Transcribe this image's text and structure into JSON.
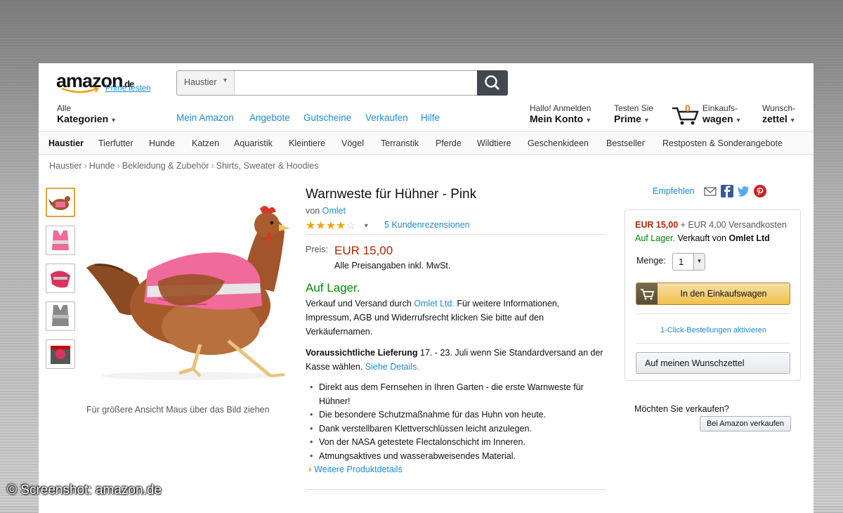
{
  "header": {
    "logo_text": "amazon",
    "logo_tld": ".de",
    "prime_link": "Prime testen",
    "search": {
      "category": "Haustier",
      "placeholder": ""
    },
    "all_categories_small": "Alle",
    "all_categories_big": "Kategorien",
    "nav_links": [
      "Mein Amazon",
      "Angebote",
      "Gutscheine",
      "Verkaufen",
      "Hilfe"
    ],
    "account": {
      "small": "Hallo! Anmelden",
      "big": "Mein Konto"
    },
    "prime": {
      "small": "Testen Sie",
      "big": "Prime"
    },
    "cart": {
      "count": "0",
      "small": "Einkaufs-",
      "big": "wagen"
    },
    "wishlist": {
      "small": "Wunsch-",
      "big": "zettel"
    }
  },
  "catbar": [
    "Haustier",
    "Tierfutter",
    "Hunde",
    "Katzen",
    "Aquaristik",
    "Kleintiere",
    "Vögel",
    "Terraristik",
    "Pferde",
    "Wildtiere",
    "Geschenkideen",
    "Bestseller",
    "Restposten & Sonderangebote"
  ],
  "breadcrumb": [
    "Haustier",
    "Hunde",
    "Bekleidung & Zubehör",
    "Shirts, Sweater & Hoodies"
  ],
  "image_hint": "Für größere Ansicht Maus über das Bild ziehen",
  "product": {
    "title": "Warnweste für Hühner - Pink",
    "by_label": "von",
    "brand": "Omlet",
    "rating": 3.5,
    "stars_display": "★★★★",
    "stars_empty": "☆",
    "reviews": "5 Kundenrezensionen",
    "price_label": "Preis:",
    "price": "EUR 15,00",
    "price_note": "Alle Preisangaben inkl. MwSt.",
    "stock": "Auf Lager.",
    "ship_pre": "Verkauf und Versand durch ",
    "ship_seller": "Omlet Ltd.",
    "ship_post": " Für weitere Informationen, Impressum, AGB und Widerrufsrecht klicken Sie bitte auf den Verkäufernamen.",
    "delivery_bold": "Voraussichtliche Lieferung",
    "delivery_text": " 17. - 23. Juli wenn Sie Standardversand an der Kasse wählen. ",
    "delivery_link": "Siehe Details.",
    "bullets": [
      "Direkt aus dem Fernsehen in Ihren Garten - die erste Warnweste für Hühner!",
      "Die besondere Schutzmaßnahme für das Huhn von heute.",
      "Dank verstellbaren Klettverschlüssen leicht anzulegen.",
      "Von der NASA getestete Flectalonschicht im Inneren.",
      "Atmungsaktives und wasserabweisendes Material."
    ],
    "more_details": "Weitere Produktdetails"
  },
  "share": {
    "label": "Empfehlen"
  },
  "buybox": {
    "price": "EUR 15,00",
    "shipping": " + EUR 4,00 Versandkosten",
    "stock": "Auf Lager.",
    "sold_by_pre": " Verkauft von ",
    "sold_by": "Omlet Ltd",
    "qty_label": "Menge:",
    "qty_value": "1",
    "cart_button": "In den Einkaufswagen",
    "one_click": "1-Click-Bestellungen aktivieren",
    "wishlist_button": "Auf meinen Wunschzettel"
  },
  "sell": {
    "question": "Möchten Sie verkaufen?",
    "button": "Bei Amazon verkaufen"
  },
  "credit": "© Screenshot: amazon.de",
  "colors": {
    "link": "#1e8ad4",
    "price": "#b12704",
    "stock": "#008a00",
    "accent": "#e47911",
    "vest": "#f06a9a"
  }
}
